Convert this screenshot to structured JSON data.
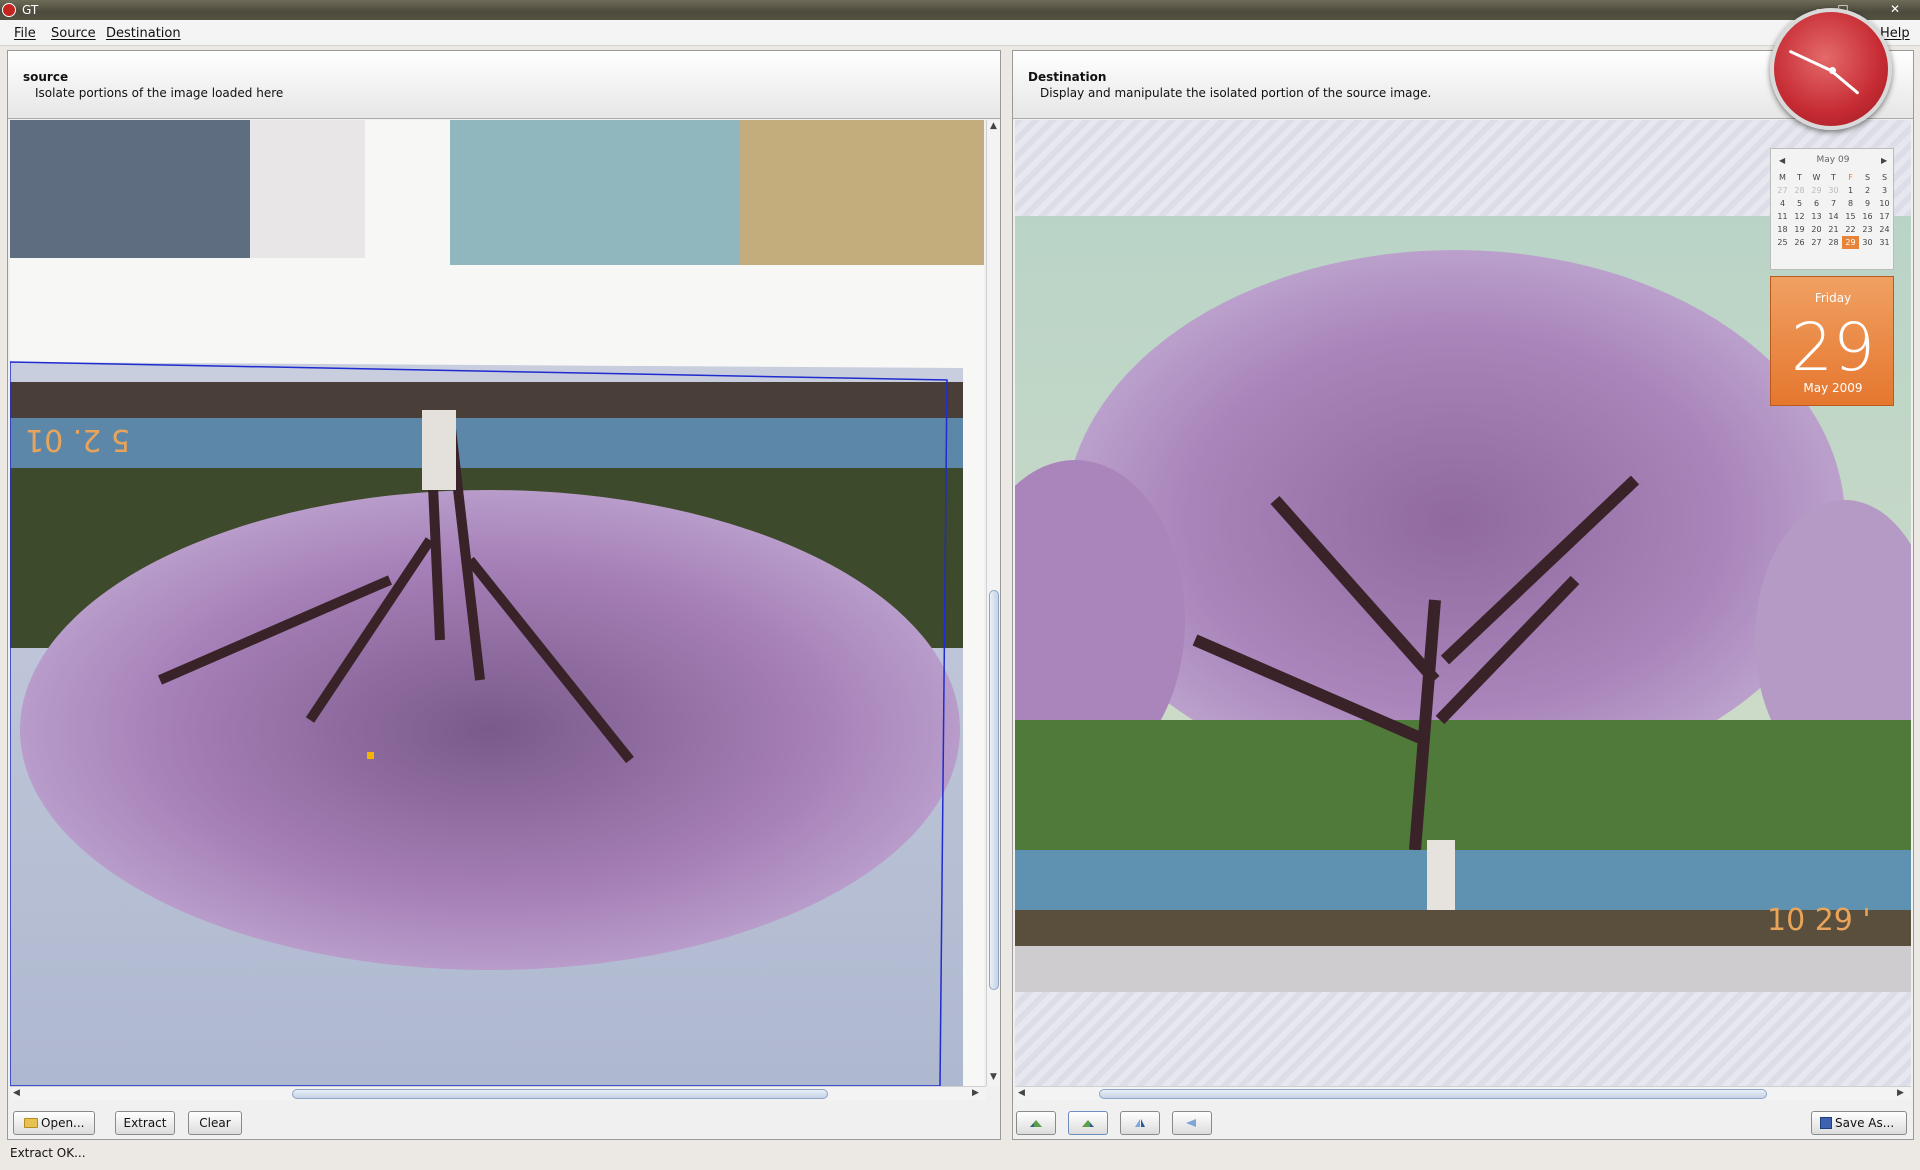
{
  "window": {
    "title": "GT"
  },
  "menu": {
    "file": "File",
    "source": "Source",
    "destination": "Destination",
    "help": "Help"
  },
  "source_panel": {
    "title": "source",
    "subtitle": "Isolate portions of the image loaded here",
    "buttons": {
      "open": "Open...",
      "extract": "Extract",
      "clear": "Clear"
    }
  },
  "destination_panel": {
    "title": "Destination",
    "subtitle": "Display and manipulate the isolated portion of the source image.",
    "buttons": {
      "save": "Save As..."
    },
    "tools": [
      "rotate-left-icon",
      "rotate-right-icon",
      "flip-vertical-icon",
      "flip-horizontal-icon"
    ]
  },
  "status": {
    "message": "Extract OK..."
  },
  "calendar": {
    "month_title": "May 09",
    "weekdays": [
      "M",
      "T",
      "W",
      "T",
      "F",
      "S",
      "S"
    ],
    "weeks": [
      [
        "27",
        "28",
        "29",
        "30",
        "1",
        "2",
        "3"
      ],
      [
        "4",
        "5",
        "6",
        "7",
        "8",
        "9",
        "10"
      ],
      [
        "11",
        "12",
        "13",
        "14",
        "15",
        "16",
        "17"
      ],
      [
        "18",
        "19",
        "20",
        "21",
        "22",
        "23",
        "24"
      ],
      [
        "25",
        "26",
        "27",
        "28",
        "29",
        "30",
        "31"
      ]
    ],
    "day_name": "Friday",
    "day_number": "29",
    "month_year": "May 2009"
  },
  "photo_overlay_text": {
    "source_stamp": "5 2. 01",
    "dest_stamp": "10 29 '"
  },
  "colors": {
    "accent": "#c62b33",
    "calendar_orange": "#e5772e",
    "selection": "#1f2ccf"
  }
}
